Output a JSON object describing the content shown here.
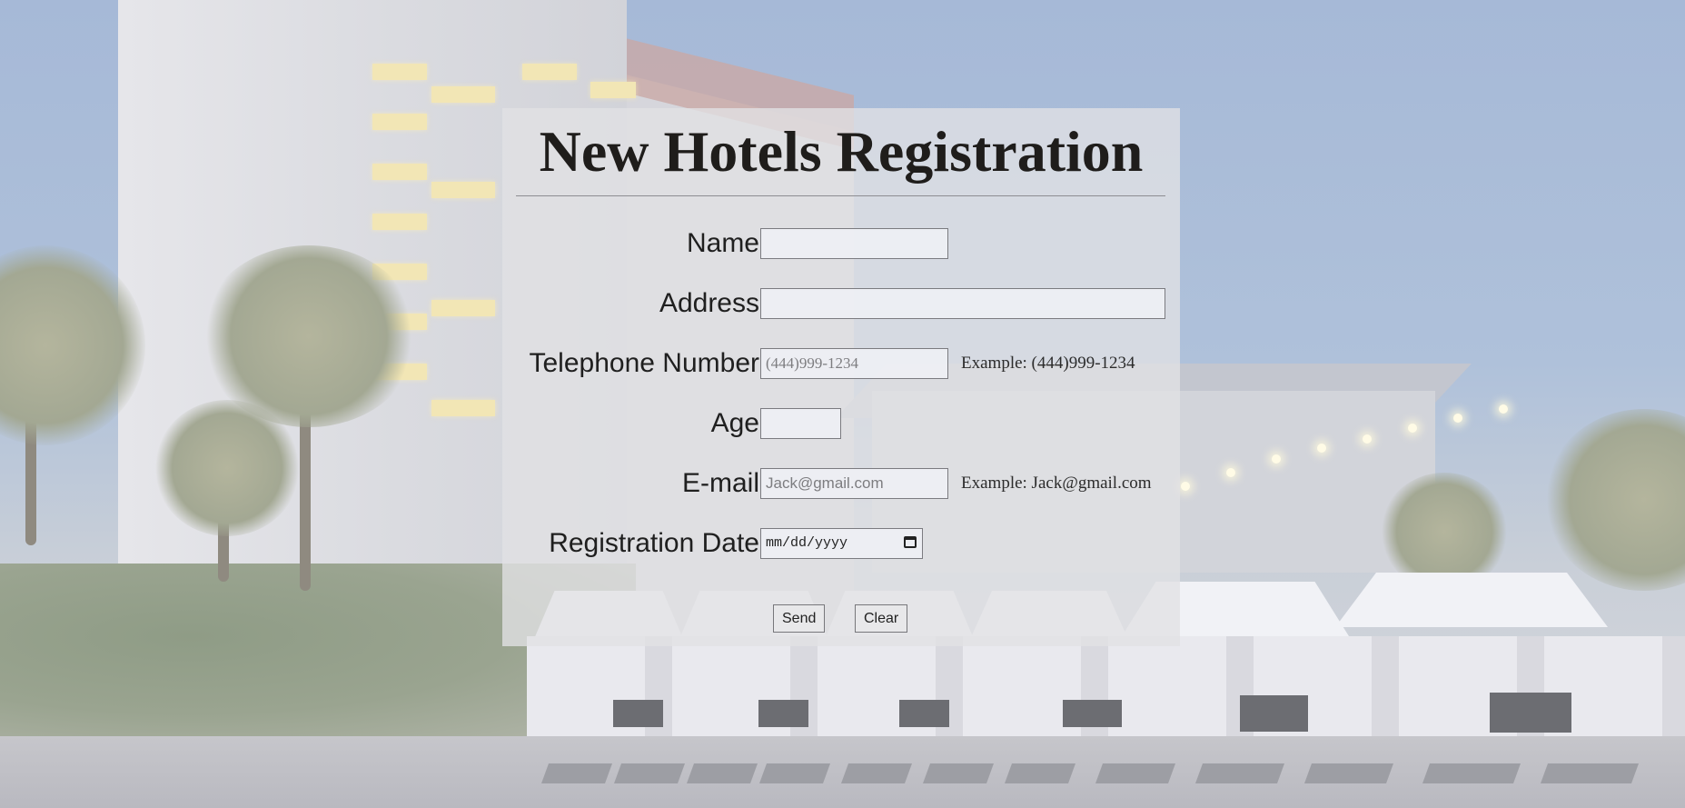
{
  "form": {
    "title": "New Hotels Registration",
    "fields": [
      {
        "label": "Name",
        "value": "",
        "placeholder": ""
      },
      {
        "label": "Address",
        "value": "",
        "placeholder": ""
      },
      {
        "label": "Telephone Number",
        "value": "",
        "placeholder": "(444)999-1234",
        "hint": "Example: (444)999-1234"
      },
      {
        "label": "Age",
        "value": "",
        "placeholder": ""
      },
      {
        "label": "E-mail",
        "value": "",
        "placeholder": "Jack@gmail.com",
        "hint": "Example: Jack@gmail.com"
      },
      {
        "label": "Registration Date",
        "value": "mm/dd/yyyy",
        "placeholder": ""
      }
    ],
    "buttons": {
      "send": "Send",
      "clear": "Clear"
    }
  },
  "icons": {
    "date_picker": "calendar-icon"
  }
}
